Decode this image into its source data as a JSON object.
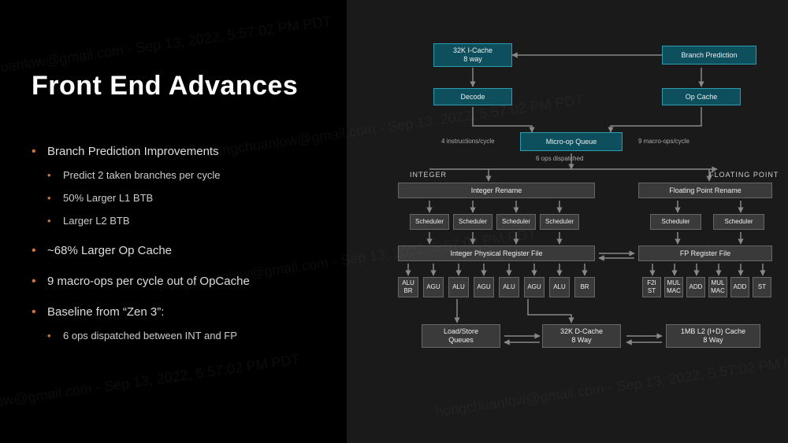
{
  "title": "Front End Advances",
  "bullets": [
    {
      "text": "Branch Prediction Improvements",
      "sub": [
        "Predict 2 taken branches per cycle",
        "50% Larger L1 BTB",
        "Larger L2 BTB"
      ]
    },
    {
      "text": "~68% Larger Op Cache"
    },
    {
      "text": "9 macro-ops per cycle out of OpCache"
    },
    {
      "text": "Baseline from “Zen 3”:",
      "sub": [
        "6 ops dispatched between INT and FP"
      ]
    }
  ],
  "diagram": {
    "icache": "32K I-Cache\n8 way",
    "branch_pred": "Branch Prediction",
    "decode": "Decode",
    "op_cache": "Op Cache",
    "uop_queue": "Micro-op Queue",
    "lbl_4inst": "4 instructions/cycle",
    "lbl_9macro": "9 macro-ops/cycle",
    "lbl_6disp": "6 ops dispatched",
    "sect_int": "INTEGER",
    "sect_fp": "FLOATING POINT",
    "int_rename": "Integer Rename",
    "scheduler": "Scheduler",
    "int_prf": "Integer Physical Register File",
    "fp_rename": "Floating Point Rename",
    "fp_rf": "FP Register File",
    "int_units": [
      "ALU\nBR",
      "AGU",
      "ALU",
      "AGU",
      "ALU",
      "AGU",
      "ALU",
      "BR"
    ],
    "fp_units": [
      "F2I\nST",
      "MUL\nMAC",
      "ADD",
      "MUL\nMAC",
      "ADD",
      "ST"
    ],
    "lsq": "Load/Store\nQueues",
    "dcache": "32K D-Cache\n8 Way",
    "l2": "1MB L2 (I+D) Cache\n8 Way"
  },
  "watermark": "hongchuanlow@gmail.com - Sep 13, 2022, 5:57:02 PM PDT",
  "colors": {
    "accent": "#d9762b",
    "teal_fill": "#0d4f5c",
    "teal_border": "#2a9db0",
    "gray_fill": "#3a3a3a"
  }
}
